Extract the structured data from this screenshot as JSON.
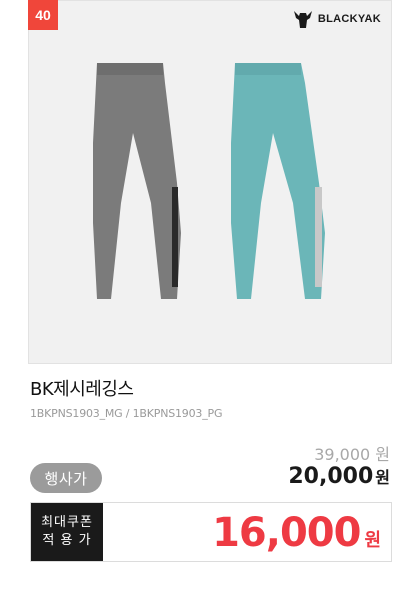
{
  "rank": "40",
  "brand": {
    "name": "BLACKYAK",
    "icon": "yak-head-icon"
  },
  "product": {
    "title": "BK제시레깅스",
    "codes": "1BKPNS1903_MG / 1BKPNS1903_PG",
    "colors": {
      "grey": "#7b7b7b",
      "mint": "#6bb6b8"
    }
  },
  "pricing": {
    "original": "39,000 원",
    "sale_label": "행사가",
    "sale_price": "20,000",
    "sale_unit": "원",
    "coupon_label_line1": "최대쿠폰",
    "coupon_label_line2": "적 용 가",
    "coupon_price": "16,000",
    "coupon_unit": "원"
  },
  "colors": {
    "badge": "#f0463a",
    "coupon_price": "#ee3a43",
    "coupon_label_bg": "#1a1a1a",
    "sale_tag_bg": "#9b9b9b"
  }
}
